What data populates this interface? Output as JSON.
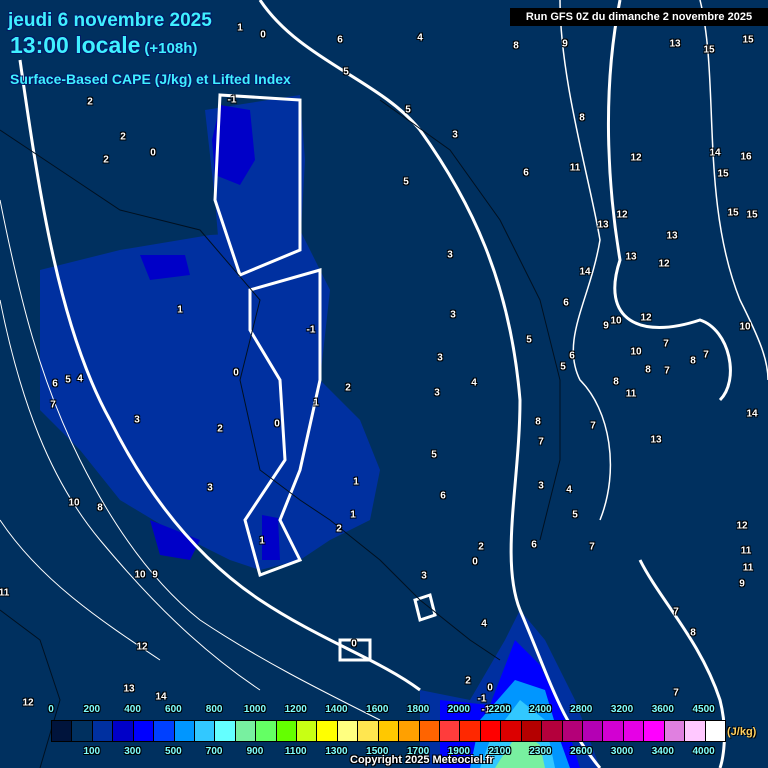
{
  "header": {
    "date": "jeudi 6 novembre 2025",
    "time": "13:00 locale",
    "lead": "(+108h)",
    "parameter": "Surface-Based CAPE (J/kg) et Lifted Index",
    "run": "Run GFS 0Z du dimanche 2 novembre 2025"
  },
  "legend": {
    "unit": "(J/kg)",
    "top_ticks": [
      "0",
      "200",
      "400",
      "600",
      "800",
      "1000",
      "1200",
      "1400",
      "1600",
      "1800",
      "2000",
      "2200",
      "2400",
      "2800",
      "3200",
      "3600",
      "4500"
    ],
    "bottom_ticks": [
      "100",
      "300",
      "500",
      "700",
      "900",
      "1100",
      "1300",
      "1500",
      "1700",
      "1900",
      "2100",
      "2300",
      "2600",
      "3000",
      "3400",
      "4000"
    ],
    "colors": [
      "#00143c",
      "#00305f",
      "#0030a0",
      "#0000c8",
      "#0000ff",
      "#0040ff",
      "#0096ff",
      "#32c8ff",
      "#64ffff",
      "#78f0a0",
      "#64ff64",
      "#64ff00",
      "#c8ff14",
      "#ffff00",
      "#ffff80",
      "#ffe650",
      "#ffc800",
      "#ffa000",
      "#ff6400",
      "#ff3c3c",
      "#ff2800",
      "#ff0000",
      "#dc0000",
      "#b40000",
      "#b4003c",
      "#b40078",
      "#b400b4",
      "#d200d2",
      "#e600e6",
      "#ff00ff",
      "#e080e0",
      "#ffc8ff",
      "#ffffff"
    ]
  },
  "copyright": "Copyright 2025 Meteociel.fr",
  "map_labels": [
    "1",
    "0",
    "6",
    "4",
    "8",
    "9",
    "13",
    "15",
    "15",
    "5",
    "2",
    "-1",
    "5",
    "8",
    "2",
    "0",
    "2",
    "3",
    "12",
    "14",
    "16",
    "5",
    "6",
    "11",
    "15",
    "15",
    "15",
    "12",
    "13",
    "13",
    "13",
    "12",
    "3",
    "14",
    "1",
    "3",
    "-1",
    "6",
    "9",
    "10",
    "12",
    "10",
    "5",
    "6",
    "10",
    "7",
    "8",
    "7",
    "3",
    "5",
    "0",
    "6",
    "5",
    "4",
    "2",
    "3",
    "4",
    "8",
    "8",
    "7",
    "11",
    "1",
    "7",
    "8",
    "7",
    "14",
    "3",
    "2",
    "0",
    "7",
    "13",
    "5",
    "1",
    "6",
    "3",
    "3",
    "4",
    "10",
    "8",
    "2",
    "1",
    "5",
    "12",
    "1",
    "6",
    "2",
    "7",
    "11",
    "0",
    "11",
    "3",
    "10",
    "9",
    "9",
    "11",
    "7",
    "4",
    "8",
    "0",
    "12",
    "13",
    "14",
    "7",
    "2",
    "12",
    "-1",
    "0",
    "-3",
    "-1"
  ]
}
